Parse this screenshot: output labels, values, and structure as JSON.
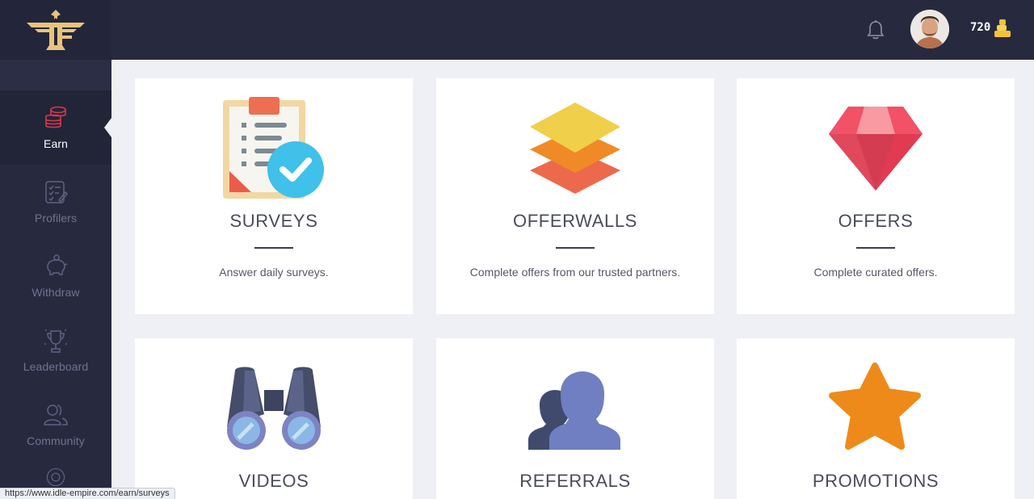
{
  "header": {
    "balance": "720",
    "icons": {
      "logo": "eagle-logo",
      "bell": "bell-icon",
      "coins": "coins-icon"
    }
  },
  "sidebar": {
    "items": [
      {
        "label": "Earn",
        "icon": "coins-stack-icon",
        "active": true
      },
      {
        "label": "Profilers",
        "icon": "checklist-icon"
      },
      {
        "label": "Withdraw",
        "icon": "piggy-bank-icon"
      },
      {
        "label": "Leaderboard",
        "icon": "trophy-icon"
      },
      {
        "label": "Community",
        "icon": "people-icon"
      }
    ]
  },
  "cards": [
    {
      "title": "SURVEYS",
      "desc": "Answer daily surveys.",
      "icon": "clipboard-check-icon"
    },
    {
      "title": "OFFERWALLS",
      "desc": "Complete offers from our trusted partners.",
      "icon": "layers-icon"
    },
    {
      "title": "OFFERS",
      "desc": "Complete curated offers.",
      "icon": "gem-icon"
    },
    {
      "title": "VIDEOS",
      "icon": "binoculars-icon"
    },
    {
      "title": "REFERRALS",
      "icon": "users-icon"
    },
    {
      "title": "PROMOTIONS",
      "icon": "star-icon"
    }
  ],
  "status_bar": {
    "url": "https://www.idle-empire.com/earn/surveys"
  },
  "colors": {
    "topbar": "#272a3f",
    "page_bg": "#eef0f6",
    "accent_red": "#e4404f"
  }
}
